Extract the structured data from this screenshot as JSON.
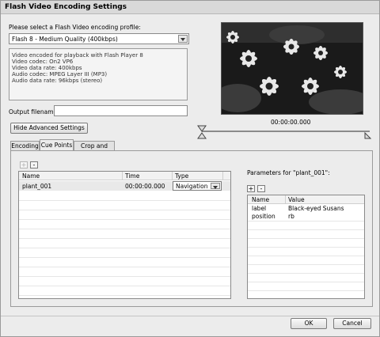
{
  "window": {
    "title": "Flash Video Encoding Settings"
  },
  "profile": {
    "prompt": "Please select a Flash Video encoding profile:",
    "selected": "Flash 8 - Medium Quality (400kbps)",
    "info": [
      "Video encoded for playback with Flash Player 8",
      "Video codec: On2 VP6",
      "Video data rate: 400kbps",
      "Audio codec: MPEG Layer III (MP3)",
      "Audio data rate: 96kbps (stereo)"
    ]
  },
  "output": {
    "label": "Output filename:",
    "value": ""
  },
  "advanced_button": "Hide Advanced Settings",
  "preview": {
    "timecode": "00:00:00.000"
  },
  "tabs": [
    "Encoding",
    "Cue Points",
    "Crop and Trim"
  ],
  "cue_points": {
    "add_label": "+",
    "remove_label": "-",
    "columns": [
      "Name",
      "Time",
      "Type"
    ],
    "rows": [
      {
        "name": "plant_001",
        "time": "00:00:00.000",
        "type": "Navigation"
      }
    ]
  },
  "parameters": {
    "title": "Parameters for \"plant_001\":",
    "add_label": "+",
    "remove_label": "-",
    "columns": [
      "Name",
      "Value"
    ],
    "rows": [
      {
        "name": "label",
        "value": "Black-eyed Susans"
      },
      {
        "name": "position",
        "value": "rb"
      }
    ]
  },
  "footer": {
    "ok": "OK",
    "cancel": "Cancel"
  }
}
